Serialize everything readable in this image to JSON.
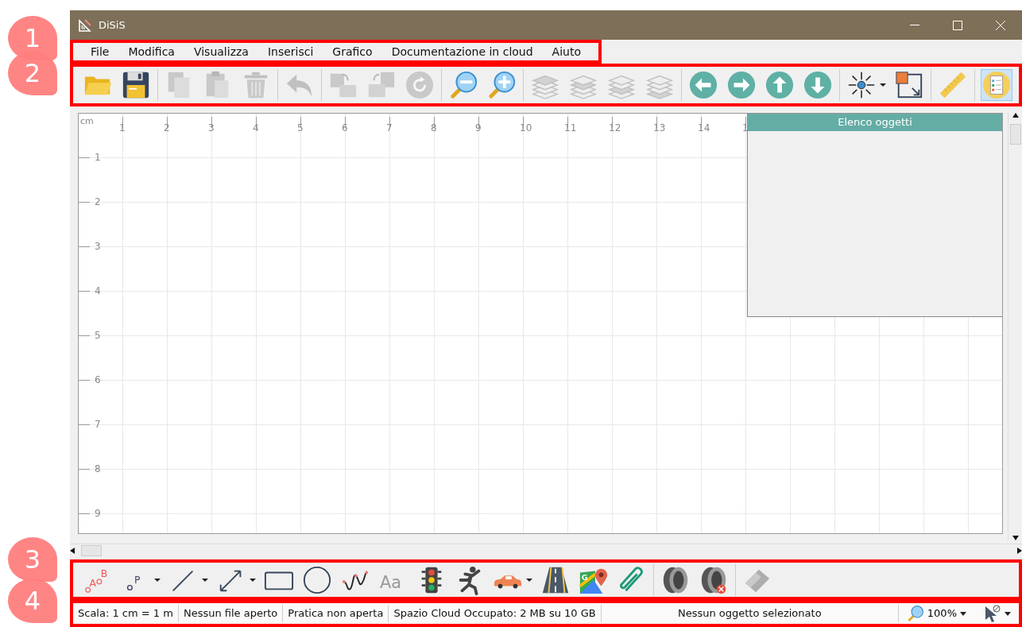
{
  "window": {
    "title": "DiSiS"
  },
  "callouts": [
    "1",
    "2",
    "3",
    "4"
  ],
  "menu": [
    "File",
    "Modifica",
    "Visualizza",
    "Inserisci",
    "Grafico",
    "Documentazione in cloud",
    "Aiuto"
  ],
  "toolbar": {
    "groups": [
      [
        {
          "kind": "folder",
          "disabled": false,
          "selected": false,
          "menu": false
        },
        {
          "kind": "save",
          "disabled": false,
          "selected": false,
          "menu": false
        }
      ],
      [
        {
          "kind": "copy",
          "disabled": true,
          "selected": false,
          "menu": false
        },
        {
          "kind": "paste",
          "disabled": true,
          "selected": false,
          "menu": false
        },
        {
          "kind": "trash",
          "disabled": true,
          "selected": false,
          "menu": false
        }
      ],
      [
        {
          "kind": "undo",
          "disabled": true,
          "selected": false,
          "menu": false
        }
      ],
      [
        {
          "kind": "forward",
          "disabled": true,
          "selected": false,
          "menu": false
        },
        {
          "kind": "backward",
          "disabled": true,
          "selected": false,
          "menu": false
        },
        {
          "kind": "rotate",
          "disabled": true,
          "selected": false,
          "menu": false
        }
      ],
      [
        {
          "kind": "zoomout",
          "disabled": false,
          "selected": false,
          "menu": false
        },
        {
          "kind": "zoomin",
          "disabled": false,
          "selected": false,
          "menu": false
        }
      ],
      [
        {
          "kind": "layer0",
          "disabled": true,
          "selected": false,
          "menu": false
        },
        {
          "kind": "layer1",
          "disabled": true,
          "selected": false,
          "menu": false
        },
        {
          "kind": "layer2",
          "disabled": true,
          "selected": false,
          "menu": false
        },
        {
          "kind": "layer3",
          "disabled": true,
          "selected": false,
          "menu": false
        }
      ],
      [
        {
          "kind": "left",
          "disabled": false,
          "selected": false,
          "menu": false
        },
        {
          "kind": "right",
          "disabled": false,
          "selected": false,
          "menu": false
        },
        {
          "kind": "up",
          "disabled": false,
          "selected": false,
          "menu": false
        },
        {
          "kind": "down",
          "disabled": false,
          "selected": false,
          "menu": false
        }
      ],
      [
        {
          "kind": "move",
          "disabled": false,
          "selected": false,
          "menu": true
        },
        {
          "kind": "resize",
          "disabled": false,
          "selected": false,
          "menu": false
        }
      ],
      [
        {
          "kind": "ruler",
          "disabled": false,
          "selected": false,
          "menu": false
        }
      ],
      [
        {
          "kind": "list",
          "disabled": false,
          "selected": true,
          "menu": false
        }
      ]
    ]
  },
  "ruler": {
    "unit": "cm",
    "x_labels": [
      "1",
      "2",
      "3",
      "4",
      "5",
      "6",
      "7",
      "8",
      "9",
      "10",
      "11",
      "12",
      "13",
      "14",
      "1"
    ],
    "y_labels": [
      "1",
      "2",
      "3",
      "4",
      "5",
      "6",
      "7",
      "8",
      "9"
    ]
  },
  "objects_panel": {
    "title": "Elenco oggetti"
  },
  "draw_toolbar": {
    "groups": [
      [
        {
          "kind": "points",
          "labels": [
            "A",
            "B"
          ],
          "disabled": false,
          "menu": false
        },
        {
          "kind": "point",
          "labels": [
            "P"
          ],
          "disabled": false,
          "menu": true
        },
        {
          "kind": "line",
          "disabled": false,
          "menu": true
        },
        {
          "kind": "dimension",
          "disabled": false,
          "menu": true
        },
        {
          "kind": "rect",
          "disabled": false,
          "menu": false
        },
        {
          "kind": "circle",
          "disabled": false,
          "menu": false
        },
        {
          "kind": "curve",
          "disabled": false,
          "menu": false
        },
        {
          "kind": "text",
          "labels": [
            "Aa"
          ],
          "disabled": false,
          "menu": false
        },
        {
          "kind": "traffic",
          "disabled": false,
          "menu": false
        },
        {
          "kind": "person",
          "disabled": false,
          "menu": false
        },
        {
          "kind": "car",
          "disabled": false,
          "menu": true
        },
        {
          "kind": "road",
          "disabled": false,
          "menu": false
        },
        {
          "kind": "map",
          "labels": [
            "G"
          ],
          "disabled": false,
          "menu": false
        },
        {
          "kind": "clip",
          "disabled": false,
          "menu": false
        }
      ],
      [
        {
          "kind": "tire",
          "disabled": false,
          "menu": false
        },
        {
          "kind": "tireremove",
          "disabled": false,
          "menu": false
        }
      ],
      [
        {
          "kind": "eraser",
          "disabled": true,
          "menu": false
        }
      ]
    ]
  },
  "status_bar": {
    "sections": [
      "Scala: 1 cm = 1 m",
      "Nessun file aperto",
      "Pratica non aperta",
      "Spazio Cloud Occupato: 2 MB su 10 GB"
    ],
    "message": "Nessun oggetto selezionato",
    "zoom": "100%"
  }
}
